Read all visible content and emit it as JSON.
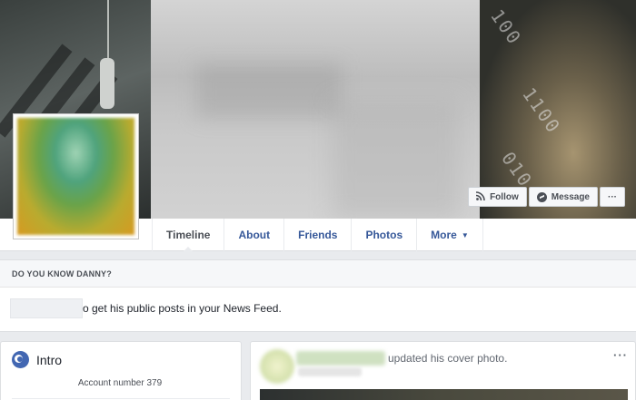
{
  "cover": {
    "digits": [
      "100",
      "1100",
      "010"
    ],
    "actions": {
      "follow_label": "Follow",
      "message_label": "Message",
      "more_label": "···"
    }
  },
  "nav": {
    "tabs": [
      {
        "label": "Timeline",
        "active": true
      },
      {
        "label": "About"
      },
      {
        "label": "Friends"
      },
      {
        "label": "Photos"
      },
      {
        "label": "More",
        "caret": "▼"
      }
    ]
  },
  "know_box": {
    "title": "DO YOU KNOW DANNY?",
    "text": "o get his public posts in your News Feed."
  },
  "intro": {
    "title": "Intro",
    "account": "Account number 379"
  },
  "post": {
    "action_text": "updated his cover photo.",
    "menu": "···"
  },
  "colors": {
    "link": "#365899",
    "page_bg": "#e9ebee",
    "accent": "#4267b2"
  }
}
